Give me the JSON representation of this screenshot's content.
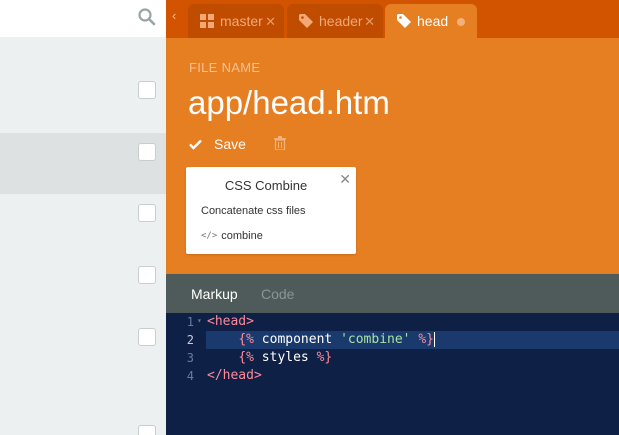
{
  "sidebar": {
    "search_icon": "search-icon",
    "rows": [
      {
        "checked": false,
        "active": false
      },
      {
        "checked": false,
        "active": true
      },
      {
        "checked": false,
        "active": false
      },
      {
        "checked": false,
        "active": false
      },
      {
        "checked": false,
        "active": false
      },
      {
        "checked": false,
        "active": false
      }
    ]
  },
  "tabs": [
    {
      "label": "master",
      "icon": "layout-icon",
      "active": false
    },
    {
      "label": "header",
      "icon": "tag-icon",
      "active": false
    },
    {
      "label": "head",
      "icon": "tag-icon",
      "active": true
    }
  ],
  "file": {
    "label": "FILE NAME",
    "name": "app/head.htm",
    "save_label": "Save"
  },
  "component": {
    "title": "CSS Combine",
    "description": "Concatenate css files",
    "alias": "combine"
  },
  "subtabs": {
    "markup": "Markup",
    "code": "Code"
  },
  "editor": {
    "line_numbers": [
      "1",
      "2",
      "3",
      "4"
    ],
    "lines": [
      "<head>",
      "    {% component 'combine' %}",
      "    {% styles %}",
      "</head>"
    ],
    "active_line": 2
  },
  "colors": {
    "tabbar": "#d35400",
    "header": "#e67e22",
    "subtabs": "#4f5b5a",
    "editor": "#0e2046"
  }
}
